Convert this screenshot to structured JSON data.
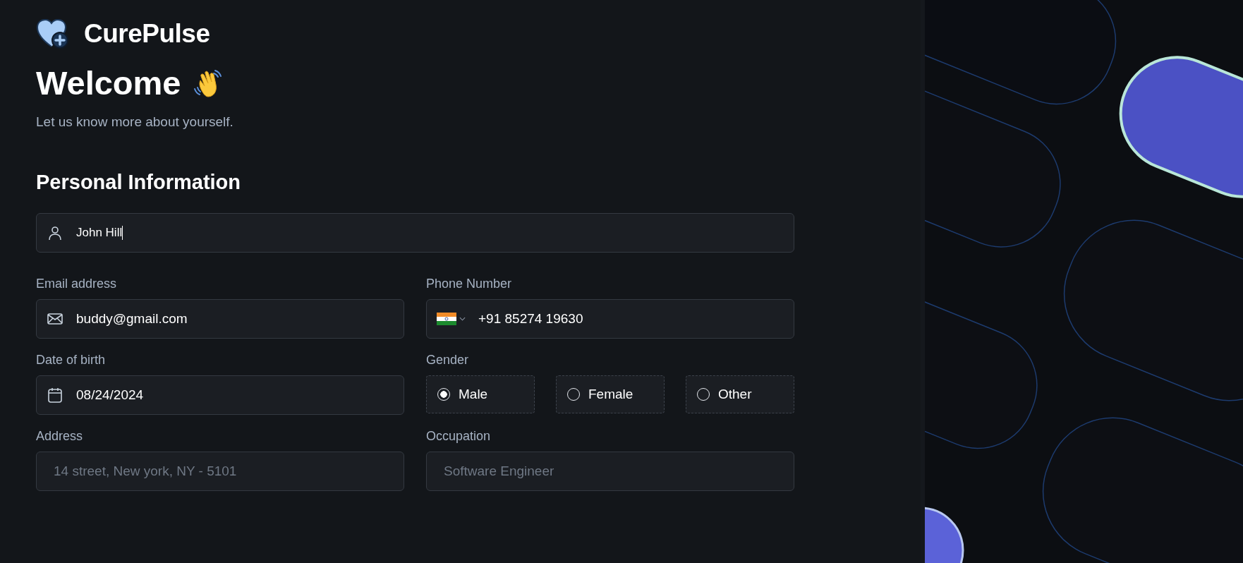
{
  "brand": {
    "name": "CurePulse"
  },
  "heading": "Welcome",
  "subtitle": "Let us know more about yourself.",
  "section_title": "Personal Information",
  "name_field": {
    "value": "John Hill",
    "focused": true
  },
  "email": {
    "label": "Email address",
    "value": "buddy@gmail.com"
  },
  "phone": {
    "label": "Phone Number",
    "value": "+91 85274 19630"
  },
  "dob": {
    "label": "Date of birth",
    "value": "08/24/2024"
  },
  "gender": {
    "label": "Gender",
    "options": [
      {
        "label": "Male",
        "selected": true
      },
      {
        "label": "Female",
        "selected": false
      },
      {
        "label": "Other",
        "selected": false
      }
    ]
  },
  "address": {
    "label": "Address",
    "placeholder": "14 street, New york, NY - 5101"
  },
  "occupation": {
    "label": "Occupation",
    "placeholder": "Software Engineer"
  }
}
